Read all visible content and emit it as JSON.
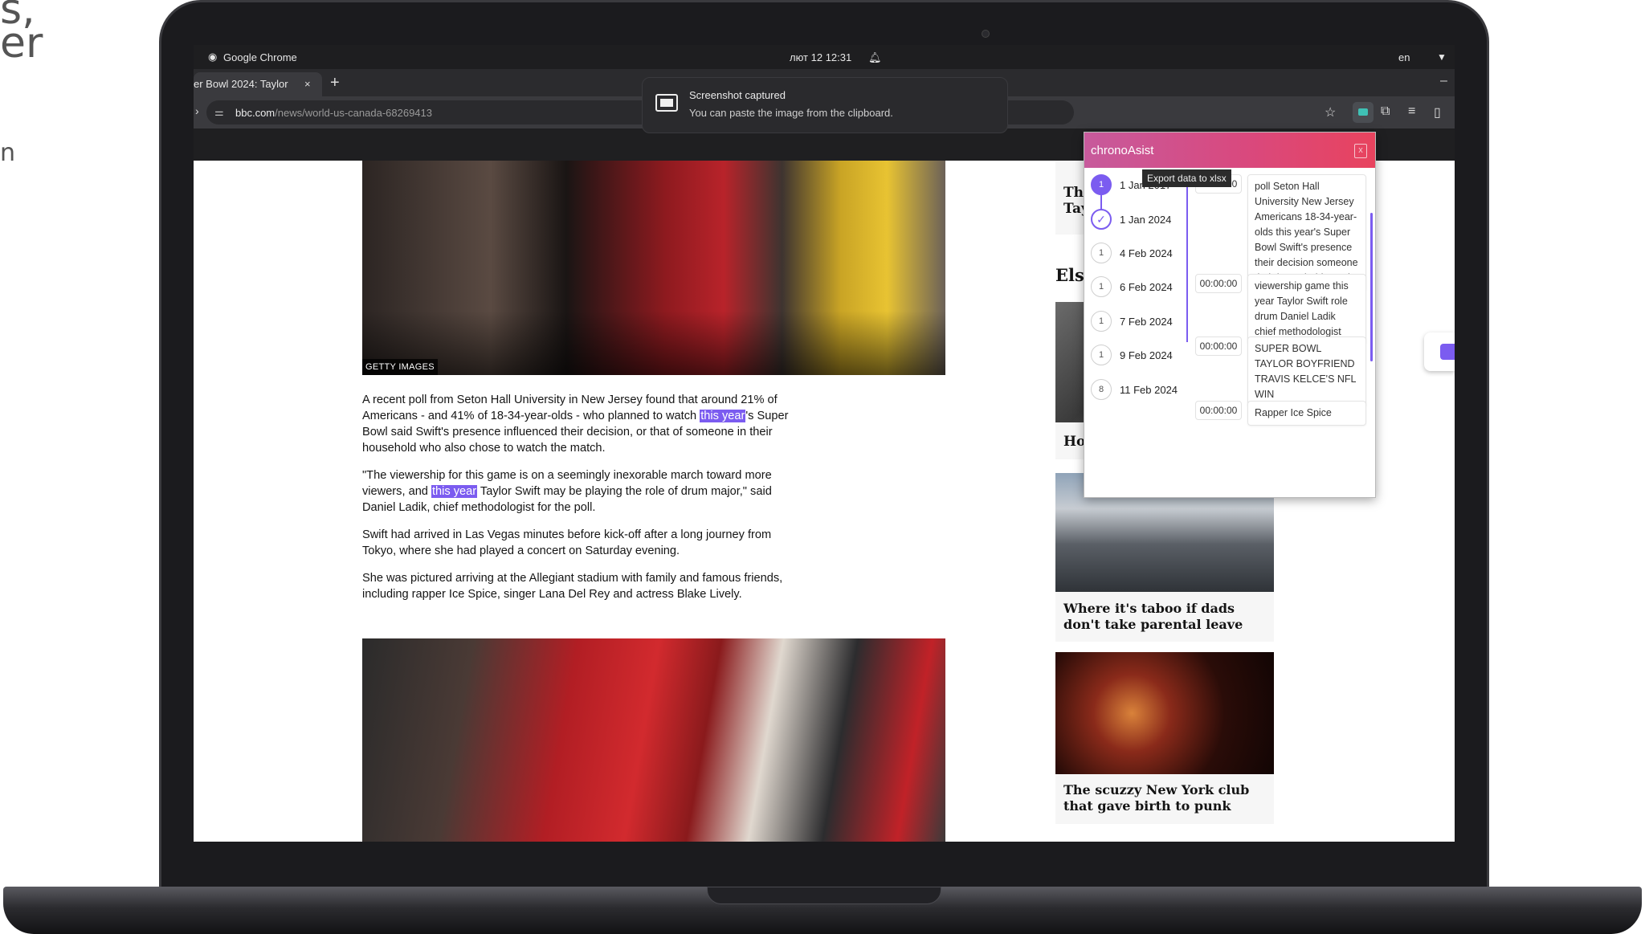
{
  "left_fragment": [
    "s,",
    "er",
    "n"
  ],
  "system_bar": {
    "app_name": "Google Chrome",
    "datetime": "лют 12  12:31",
    "language": "en"
  },
  "browser": {
    "tab_title": "er Bowl 2024: Taylor",
    "tab_close": "×",
    "new_tab": "+",
    "url_host": "bbc.com",
    "url_path": "/news/world-us-canada-68269413"
  },
  "toast": {
    "title": "Screenshot captured",
    "message": "You can paste the image from the clipboard."
  },
  "article": {
    "photo_credit": "GETTY IMAGES",
    "para1_a": "A recent poll from Seton Hall University in New Jersey found that around 21% of Americans - and 41% of 18-34-year-olds - who planned to watch ",
    "para1_hl": "this year",
    "para1_b": "'s Super Bowl said Swift's presence influenced their decision, or that of someone in their household who also chose to watch the match.",
    "para2_a": "\"The viewership for this game is on a seemingly inexorable march toward more viewers, and ",
    "para2_hl": "this year",
    "para2_b": " Taylor Swift may be playing the role of drum major,\" said Daniel Ladik, chief methodologist for the poll.",
    "para3": "Swift had arrived in Las Vegas minutes before kick-off after a long journey from Tokyo, where she had played a concert on Saturday evening.",
    "para4": "She was pictured arriving at the Allegiant stadium with family and famous friends, including rapper Ice Spice, singer Lana Del Rey and actress Blake Lively."
  },
  "sidebar": {
    "frag_the": "The",
    "frag_tay": "Tay",
    "frag_else": "Else",
    "frag_ho": "Ho",
    "story1_title": "Where it's taboo if dads don't take parental leave",
    "story2_title": "The scuzzy New York club that gave birth to punk"
  },
  "popup": {
    "title": "chronoAsist",
    "tooltip": "Export data to xlsx",
    "timeline": [
      {
        "count": "1",
        "date": "1 Jan 2017",
        "state": "active"
      },
      {
        "count": "✓",
        "date": "1 Jan 2024",
        "state": "done"
      },
      {
        "count": "1",
        "date": "4 Feb 2024",
        "state": "normal"
      },
      {
        "count": "1",
        "date": "6 Feb 2024",
        "state": "normal"
      },
      {
        "count": "1",
        "date": "7 Feb 2024",
        "state": "normal"
      },
      {
        "count": "1",
        "date": "9 Feb 2024",
        "state": "normal"
      },
      {
        "count": "8",
        "date": "11 Feb 2024",
        "state": "normal"
      }
    ],
    "events": [
      {
        "time": "00:00:00",
        "text": "poll Seton Hall University New Jersey Americans 18-34-year-olds this year's Super Bowl Swift's presence their decision someone their household match"
      },
      {
        "time": "00:00:00",
        "text": "viewership game this year Taylor Swift role drum Daniel Ladik chief methodologist"
      },
      {
        "time": "00:00:00",
        "text": "SUPER BOWL TAYLOR BOYFRIEND TRAVIS KELCE'S NFL WIN"
      },
      {
        "time": "00:00:00",
        "text": "Rapper Ice Spice"
      }
    ]
  },
  "colors": {
    "accent": "#7b5cf0",
    "popup_header_start": "#c75a9c",
    "popup_header_end": "#e8435e",
    "browser_chrome": "#3a3a3e"
  },
  "icons": [
    "chrome-icon",
    "bell-icon",
    "wifi-icon",
    "site-settings-icon",
    "bookmark-star-icon",
    "chronoasist-extension-icon",
    "puzzle-extensions-icon",
    "media-control-icon",
    "screenshot-icon",
    "xlsx-export-icon",
    "check-icon"
  ]
}
